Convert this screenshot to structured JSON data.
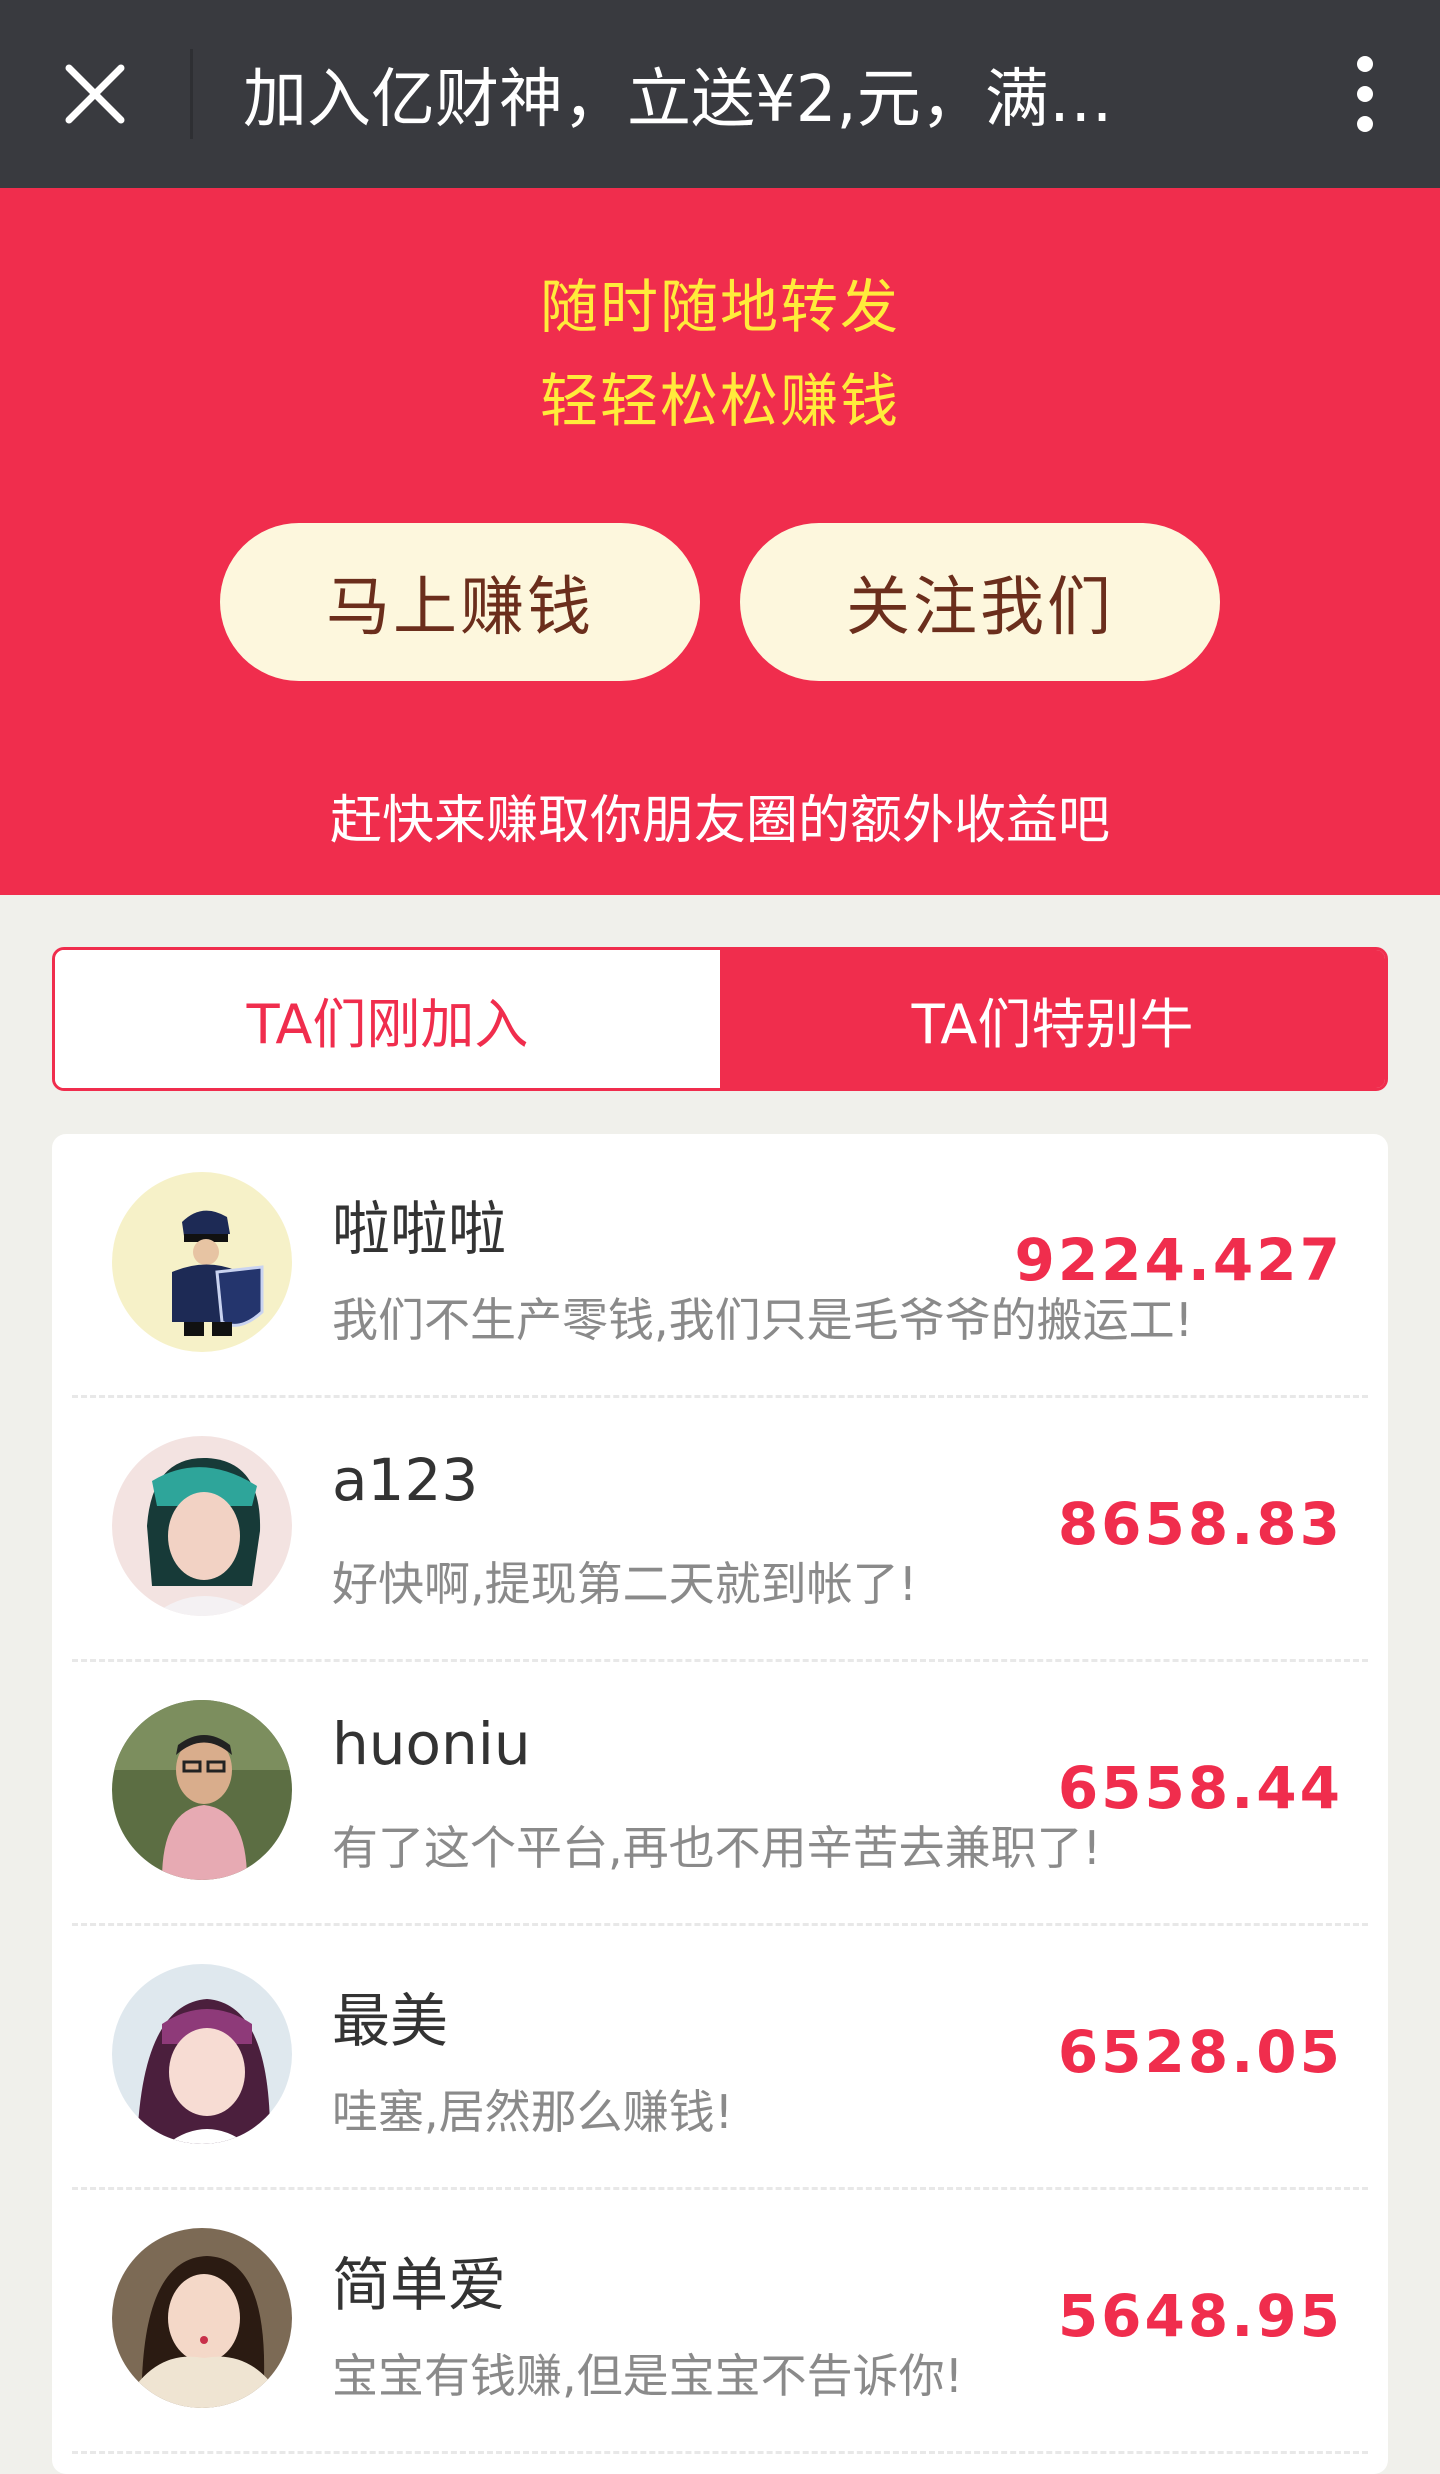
{
  "topbar": {
    "title": "加入亿财神，立送¥2,元，满…",
    "close_icon": "close-icon",
    "more_icon": "more-vertical-icon"
  },
  "hero": {
    "slogan_line1": "随时随地转发",
    "slogan_line2": "轻轻松松赚钱",
    "earn_button": "马上赚钱",
    "follow_button": "关注我们",
    "subtitle": "赶快来赚取你朋友圈的额外收益吧"
  },
  "tabs": [
    {
      "label": "TA们刚加入",
      "active": false
    },
    {
      "label": "TA们特别牛",
      "active": true
    }
  ],
  "users": [
    {
      "name": "啦啦啦",
      "message": "我们不生产零钱,我们只是毛爷爷的搬运工!",
      "amount": "9224.427",
      "avatar": "cyber-police-avatar"
    },
    {
      "name": "a123",
      "message": "好快啊,提现第二天就到帐了!",
      "amount": "8658.83",
      "avatar": "girl-green-hair-avatar"
    },
    {
      "name": "huoniu",
      "message": "有了这个平台,再也不用辛苦去兼职了!",
      "amount": "6558.44",
      "avatar": "man-glasses-avatar"
    },
    {
      "name": "最美",
      "message": "哇塞,居然那么赚钱!",
      "amount": "6528.05",
      "avatar": "girl-purple-hair-avatar"
    },
    {
      "name": "简单爱",
      "message": "宝宝有钱赚,但是宝宝不告诉你!",
      "amount": "5648.95",
      "avatar": "girl-fur-collar-avatar"
    }
  ],
  "colors": {
    "accent_red": "#f02d4d",
    "slogan_yellow": "#ffeb3b",
    "button_cream": "#fdf7dd",
    "topbar_dark": "#393a3f"
  }
}
